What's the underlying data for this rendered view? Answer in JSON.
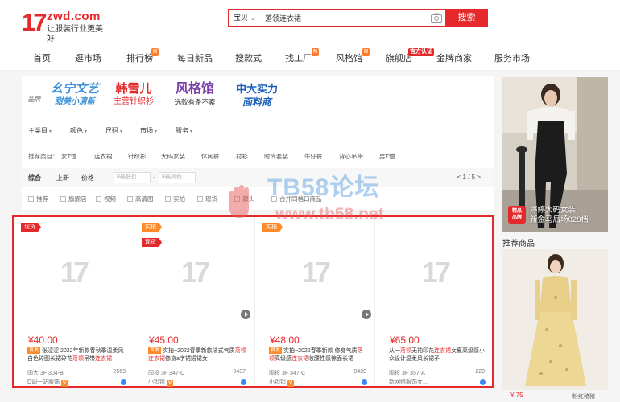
{
  "header": {
    "logo_mark": "17",
    "logo_domain": "zwd.com",
    "logo_slogan": "让服装行业更美好",
    "search_scope": "宝贝",
    "search_value": "落领连衣裙",
    "search_button": "搜索"
  },
  "nav": {
    "items": [
      {
        "label": "首页",
        "badge": ""
      },
      {
        "label": "逛市场",
        "badge": ""
      },
      {
        "label": "排行榜",
        "badge": "H"
      },
      {
        "label": "每日新品",
        "badge": ""
      },
      {
        "label": "搜款式",
        "badge": ""
      },
      {
        "label": "找工厂",
        "badge": "N"
      },
      {
        "label": "风格馆",
        "badge": "H"
      },
      {
        "label": "旗舰店",
        "badge": "官方认证"
      },
      {
        "label": "金牌商家",
        "badge": ""
      },
      {
        "label": "服务市场",
        "badge": ""
      }
    ]
  },
  "filter": {
    "brand_label": "品牌",
    "brands": [
      {
        "l1": "幺宁文艺",
        "l2": "甜美小清新",
        "color": "#3a8fd8"
      },
      {
        "l1": "韩雪儿",
        "l2": "主营针织衫",
        "color": "#e5292b"
      },
      {
        "l1": "风格馆",
        "l2": "选款有条不紊",
        "color": "#7b3fa8"
      },
      {
        "l1": "中大实力",
        "l2": "面料商",
        "color": "#1d5fb8"
      }
    ],
    "dropdowns": [
      "主类目",
      "颜色",
      "尺码",
      "市场",
      "服务"
    ],
    "cat_label": "推荐类目：",
    "cats": [
      "女T恤",
      "连衣裙",
      "针织衫",
      "大码女装",
      "休闲裤",
      "衬衫",
      "时尚套装",
      "牛仔裤",
      "背心吊带",
      "男T恤"
    ],
    "sort": {
      "composite": "综合",
      "new": "上新",
      "price": "价格",
      "min_placeholder": "¥最低价",
      "max_placeholder": "¥最高价",
      "pager": "< 1 / 5 >"
    },
    "checks": [
      "推荐",
      "旗舰店",
      "视频",
      "高清图",
      "实拍",
      "现货",
      "源头",
      "合并同档口商品"
    ]
  },
  "products": [
    {
      "tags": [
        {
          "text": "现货",
          "color": "red"
        }
      ],
      "price": "¥40.00",
      "first": "首发",
      "title_pre": "张涩涩 2022年新款春秋季温柔风白色碎图长裙碎花",
      "title_hl1": "落领",
      "title_mid": "吊带",
      "title_hl2": "连衣裙",
      "title_post": "",
      "loc": "国大 3F 304-B",
      "sales": "2563",
      "shop": "D调一站服饰",
      "video": false
    },
    {
      "tags": [
        {
          "text": "实拍",
          "color": "orange"
        },
        {
          "text": "现货",
          "color": "red"
        }
      ],
      "price": "¥45.00",
      "first": "首发",
      "title_pre": "实拍~2022春季新款法式气质",
      "title_hl1": "落领",
      "title_mid": "",
      "title_hl2": "连衣裙",
      "title_post": "修身a字裙短裙女",
      "loc": "国投 3F 347-C",
      "sales": "9437",
      "shop": "小钽钽",
      "video": true
    },
    {
      "tags": [
        {
          "text": "实拍",
          "color": "orange"
        }
      ],
      "price": "¥48.00",
      "first": "首发",
      "title_pre": "实拍~2022春季新款 修身气质",
      "title_hl1": "落领",
      "title_mid": "高级感",
      "title_hl2": "连衣裙",
      "title_post": "收腰性感惊面长裙",
      "loc": "国投 3F 347-C",
      "sales": "9420",
      "shop": "小钽钽",
      "video": true
    },
    {
      "tags": [],
      "price": "¥65.00",
      "first": "",
      "title_pre": "从一",
      "title_hl1": "落领",
      "title_mid": "无袖印花",
      "title_hl2": "连衣裙",
      "title_post": "女夏高级感小众设计温柔风长裙子",
      "loc": "国投 3F 357-A",
      "sales": "220",
      "shop": "新网络服饰女...",
      "video": false
    }
  ],
  "side_ad": {
    "badge": "精品\n品牌",
    "line1": "婷婷大码女装",
    "line2": "新金马后场028档"
  },
  "recommend": {
    "title": "推荐商品",
    "price": "¥ 75",
    "shop": "粉红猪猪"
  },
  "watermark": {
    "line1": "TB58论坛",
    "line2": "www.tb58.net"
  }
}
